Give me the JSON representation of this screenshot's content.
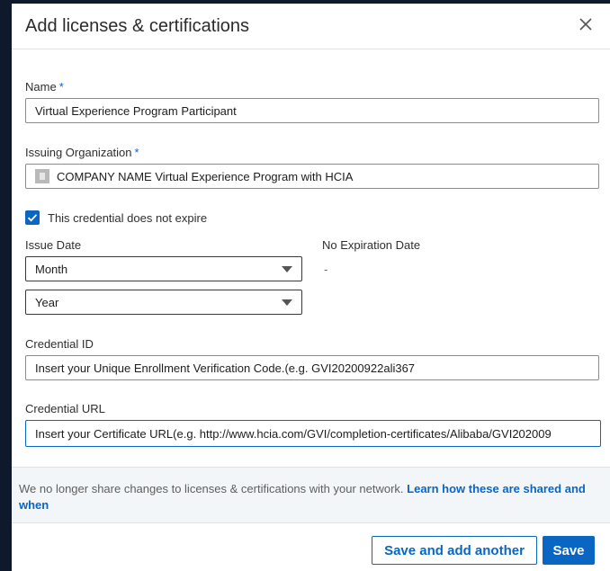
{
  "dialog": {
    "title": "Add licenses & certifications",
    "close_icon": "close-icon"
  },
  "form": {
    "name": {
      "label": "Name",
      "required_mark": "*",
      "value": "Virtual Experience Program Participant"
    },
    "issuing_org": {
      "label": "Issuing Organization",
      "required_mark": "*",
      "value": "COMPANY NAME Virtual Experience Program with HCIA"
    },
    "no_expire": {
      "label": "This credential does not expire",
      "checked": true
    },
    "issue_date": {
      "label": "Issue Date",
      "month": "Month",
      "year": "Year"
    },
    "expiration": {
      "label": "No Expiration Date",
      "value": "-"
    },
    "credential_id": {
      "label": "Credential ID",
      "value": "Insert your Unique Enrollment Verification Code.(e.g. GVI20200922ali367"
    },
    "credential_url": {
      "label": "Credential URL",
      "value": "Insert your Certificate URL(e.g. http://www.hcia.com/GVI/completion-certificates/Alibaba/GVI202009"
    }
  },
  "footer": {
    "note": "We no longer share changes to licenses & certifications with your network.",
    "link": "Learn how these are shared and when",
    "save_add_label": "Save and add another",
    "save_label": "Save"
  },
  "colors": {
    "accent": "#0a66c2",
    "backdrop": "#0e1a2b"
  }
}
